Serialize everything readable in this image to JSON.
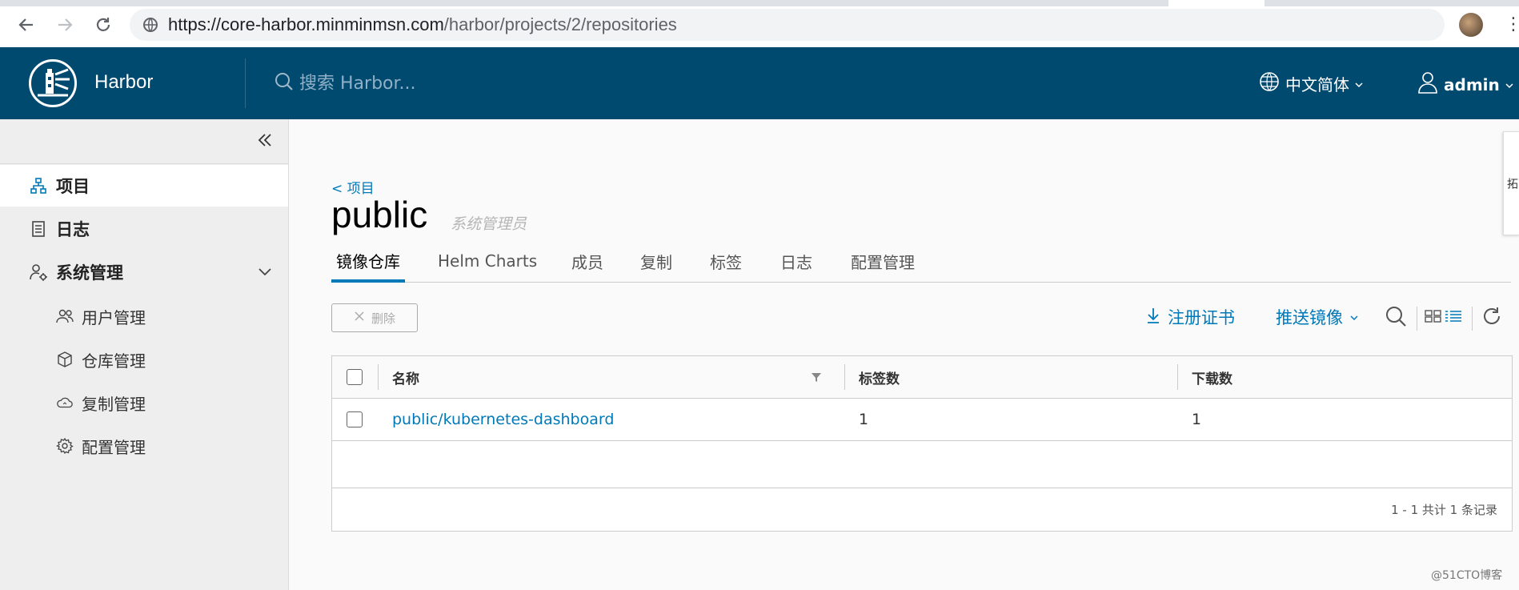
{
  "browser": {
    "url_host": "https://core-harbor.minminmsn.com",
    "url_path": "/harbor/projects/2/repositories"
  },
  "header": {
    "brand": "Harbor",
    "search_placeholder": "搜索 Harbor...",
    "language": "中文简体",
    "user": "admin",
    "bg_color": "#004a70"
  },
  "sidebar": {
    "items": [
      {
        "label": "项目",
        "icon": "project-icon"
      },
      {
        "label": "日志",
        "icon": "log-icon"
      },
      {
        "label": "系统管理",
        "icon": "admin-icon"
      }
    ],
    "sub_items": [
      {
        "label": "用户管理",
        "icon": "users-icon"
      },
      {
        "label": "仓库管理",
        "icon": "registry-icon"
      },
      {
        "label": "复制管理",
        "icon": "cloud-icon"
      },
      {
        "label": "配置管理",
        "icon": "gear-icon"
      }
    ]
  },
  "project": {
    "back_label": "< 项目",
    "name": "public",
    "role": "系统管理员",
    "tabs": [
      "镜像仓库",
      "Helm Charts",
      "成员",
      "复制",
      "标签",
      "日志",
      "配置管理"
    ]
  },
  "toolbar": {
    "delete_label": "删除",
    "cert_label": "注册证书",
    "push_label": "推送镜像"
  },
  "table": {
    "columns": [
      "名称",
      "标签数",
      "下载数"
    ],
    "rows": [
      {
        "name": "public/kubernetes-dashboard",
        "tags": "1",
        "pulls": "1"
      }
    ],
    "footer": "1 - 1 共计 1 条记录"
  },
  "side_float_text": "拓",
  "watermark": "@51CTO博客",
  "accent_color": "#0079b8"
}
